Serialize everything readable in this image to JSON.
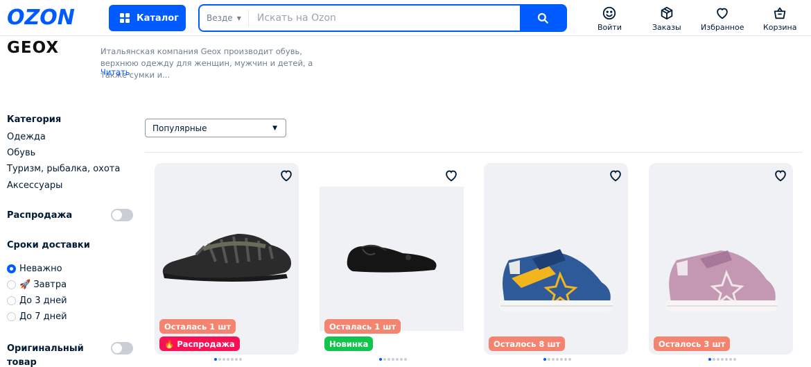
{
  "header": {
    "logo": "OZON",
    "catalog_label": "Каталог",
    "search_scope": "Везде",
    "search_placeholder": "Искать на Ozon",
    "login_label": "Войти",
    "orders_label": "Заказы",
    "favorites_label": "Избранное",
    "cart_label": "Корзина"
  },
  "brand": {
    "name": "GEOX",
    "description": "Итальянская компания Geox производит обувь, верхнюю одежду для женщин, мужчин и детей, а также сумки и...",
    "read_more": "Читать"
  },
  "sidebar": {
    "category_title": "Категория",
    "categories": [
      "Одежда",
      "Обувь",
      "Туризм, рыбалка, охота",
      "Аксессуары"
    ],
    "sale_label": "Распродажа",
    "delivery_title": "Сроки доставки",
    "delivery_options": [
      "Неважно",
      "🚀 Завтра",
      "До 3 дней",
      "До 7 дней"
    ],
    "original_label_1": "Оригинальный",
    "original_label_2": "товар"
  },
  "sort": {
    "selected": "Популярные"
  },
  "products": [
    {
      "badges": [
        "Осталась 1 шт",
        "🔥 Распродажа"
      ],
      "image": "black-sandal"
    },
    {
      "badges": [
        "Осталась 1 шт",
        "Новинка"
      ],
      "image": "black-flat-shoe"
    },
    {
      "badges": [
        "Осталось 8 шт"
      ],
      "image": "blue-yellow-sneaker"
    },
    {
      "badges": [
        "Осталось 3 шт"
      ],
      "image": "pink-sneaker"
    }
  ],
  "colors": {
    "brand": "#005bff",
    "sale": "#f91155",
    "new": "#10c44c",
    "stock": "#f4846f"
  }
}
